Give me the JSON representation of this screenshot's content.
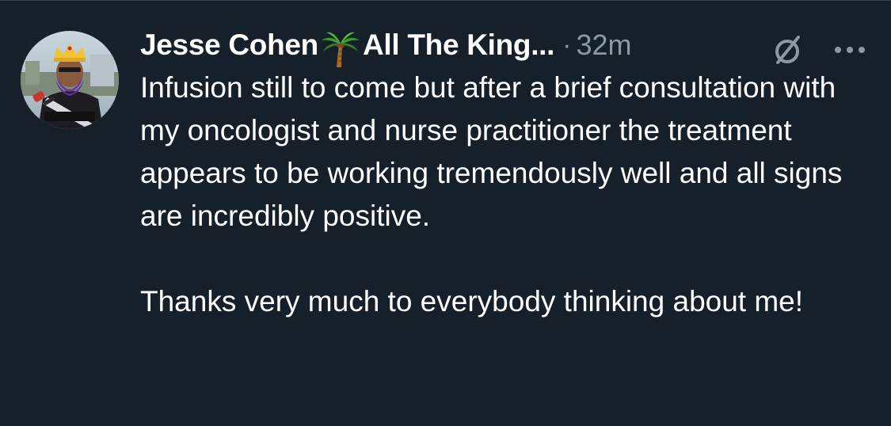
{
  "author": {
    "display_name": "Jesse Cohen",
    "display_name_suffix": "All The King...",
    "emoji_icon": "palm-tree-icon",
    "avatar_caption": "JESSE COHEN"
  },
  "meta": {
    "separator": "·",
    "timestamp": "32m"
  },
  "actions": {
    "grok_icon": "grok-slash-circle-icon",
    "more_icon": "more-dots-icon"
  },
  "body": {
    "paragraph_1": "Infusion still to come but after a brief consultation with my oncologist and nurse practitioner the treatment appears to be working tremendously well and all signs are incredibly positive.",
    "paragraph_2": "Thanks very much to everybody thinking about me!"
  },
  "colors": {
    "background": "#15202b",
    "primary_text": "#ffffff",
    "secondary_text": "#8b98a5",
    "divider": "#38444d"
  }
}
